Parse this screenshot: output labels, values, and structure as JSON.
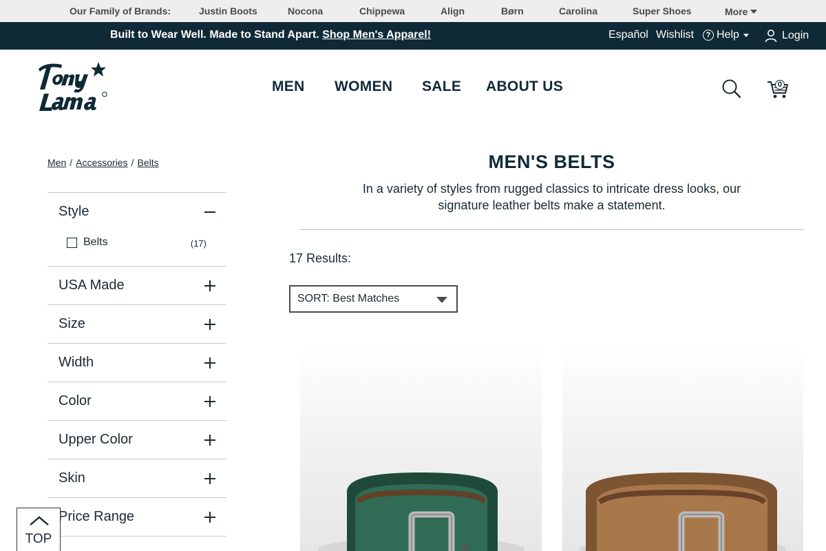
{
  "brand_bar": {
    "label": "Our Family of Brands:",
    "brands": [
      "Justin Boots",
      "Nocona",
      "Chippewa",
      "Align",
      "Børn",
      "Carolina",
      "Super Shoes"
    ],
    "more_label": "More"
  },
  "promo": {
    "text": "Built to Wear Well. Made to Stand Apart.",
    "link": "Shop Men's Apparel!"
  },
  "utility": {
    "language": "Español",
    "wishlist": "Wishlist",
    "help": "Help",
    "login": "Login"
  },
  "header": {
    "logo_text": "Tony Lama",
    "nav": [
      "MEN",
      "WOMEN",
      "SALE",
      "ABOUT US"
    ],
    "cart_count": "0"
  },
  "breadcrumb": [
    "Men",
    "Accessories",
    "Belts"
  ],
  "filters": [
    {
      "title": "Style",
      "expanded": true,
      "options": [
        {
          "label": "Belts",
          "count": "(17)"
        }
      ]
    },
    {
      "title": "USA Made",
      "expanded": false
    },
    {
      "title": "Size",
      "expanded": false
    },
    {
      "title": "Width",
      "expanded": false
    },
    {
      "title": "Color",
      "expanded": false
    },
    {
      "title": "Upper Color",
      "expanded": false
    },
    {
      "title": "Skin",
      "expanded": false
    },
    {
      "title": "Price Range",
      "expanded": false
    }
  ],
  "main": {
    "title": "MEN'S BELTS",
    "description": "In a variety of styles from rugged classics to intricate dress looks, our signature leather belts make a statement.",
    "results": "17 Results:",
    "sort_label": "SORT: Best Matches"
  },
  "products": [
    {
      "color": "#2f6b55",
      "color_dark": "#1f4a3a"
    },
    {
      "color": "#a9784a",
      "color_dark": "#7d5533"
    }
  ],
  "back_to_top": "TOP",
  "colors": {
    "navy": "#0f2a36",
    "brand_bar_bg": "#eeeeee"
  }
}
